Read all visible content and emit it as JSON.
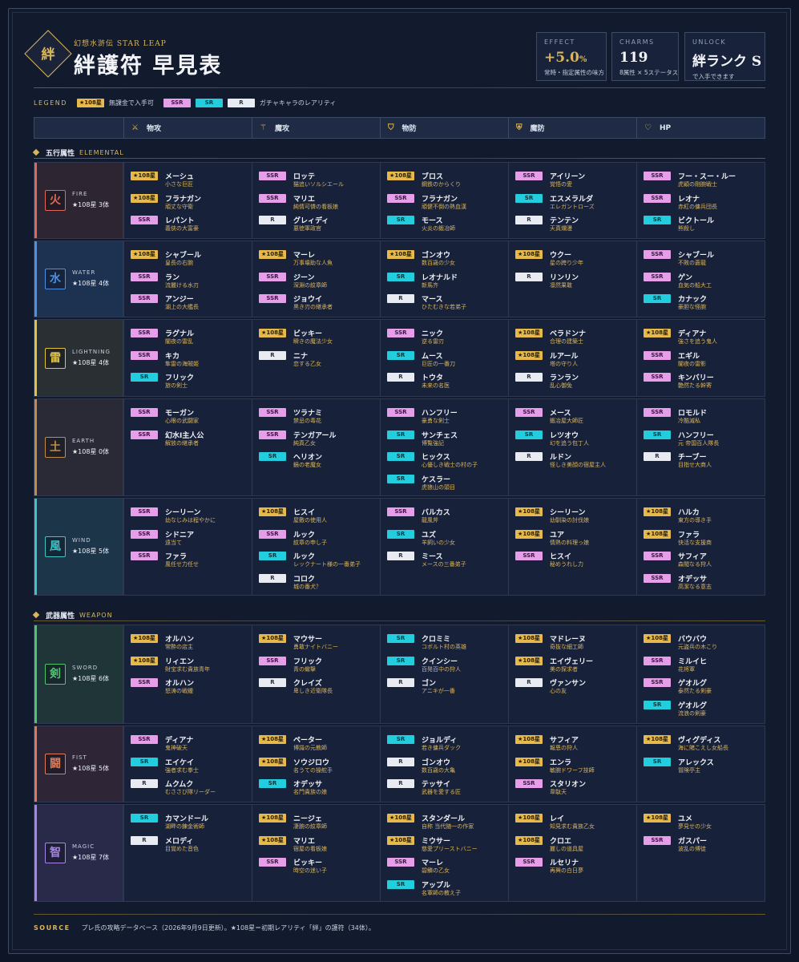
{
  "header": {
    "logo_char": "絆",
    "subtitle": "幻想水滸伝 STAR LEAP",
    "title": "絆護符 早見表"
  },
  "stats": [
    {
      "label": "EFFECT",
      "value": "+5.0",
      "unit": "%",
      "note": "常時・指定属性の味方"
    },
    {
      "label": "CHARMS",
      "value": "119",
      "note": "8属性 × 5ステータス"
    },
    {
      "label": "UNLOCK",
      "value": "絆ランク S",
      "note": "で入手できます"
    }
  ],
  "legend": {
    "title": "LEGEND",
    "star_badge": "★108星",
    "star_text": "無課金で入手可",
    "ssr": "SSR",
    "sr": "SR",
    "r": "R",
    "rarity_text": "ガチャキャラのレアリティ"
  },
  "columns": [
    {
      "label": "物攻",
      "icon": "sword-icon"
    },
    {
      "label": "魔攻",
      "icon": "wand-icon"
    },
    {
      "label": "物防",
      "icon": "shield-icon"
    },
    {
      "label": "魔防",
      "icon": "magic-shield-icon"
    },
    {
      "label": "HP",
      "icon": "heart-icon"
    }
  ],
  "colors": {
    "gold": "#d9b55c",
    "star": "#e6b94a",
    "ssr": "#e79ee8",
    "sr": "#22cddd",
    "r": "#e8ebf1"
  },
  "sections": [
    {
      "title": "五行属性",
      "title_en": "ELEMENTAL",
      "rows": [
        {
          "kanji": "火",
          "en": "FIRE",
          "count": "★108星 3体",
          "color": "#e0685a",
          "bg": "#2d2532",
          "cells": [
            [
              {
                "r": "star",
                "n": "メーシュ",
                "s": "小さな巨匠"
              },
              {
                "r": "star",
                "n": "フラナガン",
                "s": "頑丈な守衛"
              },
              {
                "r": "ssr",
                "n": "レパント",
                "s": "義俠の大富豪"
              }
            ],
            [
              {
                "r": "ssr",
                "n": "ロッテ",
                "s": "猫追いソルシエール"
              },
              {
                "r": "ssr",
                "n": "マリエ",
                "s": "純情可憐の看板娘"
              },
              {
                "r": "r",
                "n": "グレィディ",
                "s": "悪徳軍政官"
              }
            ],
            [
              {
                "r": "star",
                "n": "ブロス",
                "s": "鋼鉄のからくり"
              },
              {
                "r": "ssr",
                "n": "フラナガン",
                "s": "頑健不倒の熱血漢"
              },
              {
                "r": "sr",
                "n": "モース",
                "s": "火炎の鍛冶師"
              }
            ],
            [
              {
                "r": "ssr",
                "n": "アイリーン",
                "s": "覚悟の愛"
              },
              {
                "r": "sr",
                "n": "エスメラルダ",
                "s": "エレガントローズ"
              },
              {
                "r": "r",
                "n": "テンテン",
                "s": "天真爛漫"
              }
            ],
            [
              {
                "r": "ssr",
                "n": "フー・スー・ルー",
                "s": "虎穎の剛腕戦士"
              },
              {
                "r": "ssr",
                "n": "レオナ",
                "s": "赤紅の傭兵団長"
              },
              {
                "r": "sr",
                "n": "ビクトール",
                "s": "熊殺し"
              }
            ]
          ]
        },
        {
          "kanji": "水",
          "en": "WATER",
          "count": "★108星 4体",
          "color": "#4d8fe0",
          "bg": "#1d3150",
          "cells": [
            [
              {
                "r": "star",
                "n": "シャブール",
                "s": "皇長の右腕"
              },
              {
                "r": "ssr",
                "n": "ラン",
                "s": "流麗ける水刃"
              },
              {
                "r": "ssr",
                "n": "アンジー",
                "s": "湖上の大艦長"
              }
            ],
            [
              {
                "r": "star",
                "n": "マーレ",
                "s": "万事壊助な人魚"
              },
              {
                "r": "ssr",
                "n": "ジーン",
                "s": "深淵の紋章師"
              },
              {
                "r": "ssr",
                "n": "ジョウイ",
                "s": "黒き刃の継承者"
              }
            ],
            [
              {
                "r": "star",
                "n": "ゴンオウ",
                "s": "数百歳の少女"
              },
              {
                "r": "sr",
                "n": "レオナルド",
                "s": "新馬齐"
              },
              {
                "r": "r",
                "n": "マース",
                "s": "ひたむきな若弟子"
              }
            ],
            [
              {
                "r": "star",
                "n": "ウクー",
                "s": "星の跨り少年"
              },
              {
                "r": "r",
                "n": "リンリン",
                "s": "凛然果敢"
              }
            ],
            [
              {
                "r": "ssr",
                "n": "シャブール",
                "s": "不敗の蒼龍"
              },
              {
                "r": "ssr",
                "n": "ゲン",
                "s": "血気の船大工"
              },
              {
                "r": "sr",
                "n": "カナック",
                "s": "豪胆な怪腕"
              }
            ]
          ]
        },
        {
          "kanji": "雷",
          "en": "LIGHTNING",
          "count": "★108星 4体",
          "color": "#e2c43c",
          "bg": "#2a2f33",
          "cells": [
            [
              {
                "r": "ssr",
                "n": "ラグナル",
                "s": "闇夜の雷乱"
              },
              {
                "r": "ssr",
                "n": "キカ",
                "s": "隼雷の海賊姫"
              },
              {
                "r": "sr",
                "n": "フリック",
                "s": "旅の剣士"
              }
            ],
            [
              {
                "r": "star",
                "n": "ビッキー",
                "s": "瞬きの魔法少女"
              },
              {
                "r": "r",
                "n": "ニナ",
                "s": "恋する乙女"
              }
            ],
            [
              {
                "r": "ssr",
                "n": "ニック",
                "s": "逆る雷刃"
              },
              {
                "r": "sr",
                "n": "ムース",
                "s": "巨匠の一番刀"
              },
              {
                "r": "r",
                "n": "トウタ",
                "s": "未来の名医"
              }
            ],
            [
              {
                "r": "star",
                "n": "ベラドンナ",
                "s": "合理の建築士"
              },
              {
                "r": "star",
                "n": "ルアール",
                "s": "塔の守り人"
              },
              {
                "r": "r",
                "n": "ランラン",
                "s": "乱心御免"
              }
            ],
            [
              {
                "r": "star",
                "n": "ディアナ",
                "s": "強さを追う鬼人"
              },
              {
                "r": "ssr",
                "n": "エギル",
                "s": "闇夜の雷影"
              },
              {
                "r": "ssr",
                "n": "キンバリー",
                "s": "艶然たる幹寄"
              }
            ]
          ]
        },
        {
          "kanji": "土",
          "en": "EARTH",
          "count": "★108星 0体",
          "color": "#c18c4a",
          "bg": "#2a2a36",
          "cells": [
            [
              {
                "r": "ssr",
                "n": "モーガン",
                "s": "心眼の武闘家"
              },
              {
                "r": "ssr",
                "n": "幻水Ⅰ主人公",
                "s": "解放の継承者"
              }
            ],
            [
              {
                "r": "ssr",
                "n": "ツラナミ",
                "s": "禁忌の毒花"
              },
              {
                "r": "ssr",
                "n": "テンガアール",
                "s": "純真乙女"
              },
              {
                "r": "sr",
                "n": "ヘリオン",
                "s": "鏡の老魔女"
              }
            ],
            [
              {
                "r": "ssr",
                "n": "ハンフリー",
                "s": "豪勇な剣士"
              },
              {
                "r": "sr",
                "n": "サンチェス",
                "s": "博覧強記"
              },
              {
                "r": "sr",
                "n": "ヒックス",
                "s": "心優しき戦士の村の子"
              },
              {
                "r": "sr",
                "n": "ケスラー",
                "s": "虎狼山の頭目"
              }
            ],
            [
              {
                "r": "ssr",
                "n": "メース",
                "s": "鍛冶屋大師匠"
              },
              {
                "r": "sr",
                "n": "レツオウ",
                "s": "幻を追う包丁人"
              },
              {
                "r": "r",
                "n": "ルドン",
                "s": "怪しき美顔の宿屋主人"
              }
            ],
            [
              {
                "r": "ssr",
                "n": "ロモルド",
                "s": "冷酷滅私"
              },
              {
                "r": "sr",
                "n": "ハンフリー",
                "s": "元 帝国百人隊長"
              },
              {
                "r": "r",
                "n": "チーブー",
                "s": "目指せ大商人"
              }
            ]
          ]
        },
        {
          "kanji": "風",
          "en": "WIND",
          "count": "★108星 5体",
          "color": "#3fc4c6",
          "bg": "#1d3548",
          "cells": [
            [
              {
                "r": "ssr",
                "n": "シーリーン",
                "s": "幼なじみは程やかに"
              },
              {
                "r": "ssr",
                "n": "シドニア",
                "s": "遠当て"
              },
              {
                "r": "ssr",
                "n": "ファラ",
                "s": "風任せ力任せ"
              }
            ],
            [
              {
                "r": "star",
                "n": "ヒスイ",
                "s": "屋敷の使用人"
              },
              {
                "r": "ssr",
                "n": "ルック",
                "s": "紋章の申し子"
              },
              {
                "r": "sr",
                "n": "ルック",
                "s": "レックナート様の一番弟子"
              },
              {
                "r": "r",
                "n": "コロク",
                "s": "城の番犬？"
              }
            ],
            [
              {
                "r": "ssr",
                "n": "バルカス",
                "s": "龍風斧"
              },
              {
                "r": "sr",
                "n": "ユズ",
                "s": "羊飼いの少女"
              },
              {
                "r": "r",
                "n": "ミース",
                "s": "メースの三番弟子"
              }
            ],
            [
              {
                "r": "star",
                "n": "シーリーン",
                "s": "幼馴染の討伐娘"
              },
              {
                "r": "star",
                "n": "ユア",
                "s": "情熱の料理っ娘"
              },
              {
                "r": "ssr",
                "n": "ヒスイ",
                "s": "秘めうれし力"
              }
            ],
            [
              {
                "r": "star",
                "n": "ハルカ",
                "s": "東方の導き手"
              },
              {
                "r": "star",
                "n": "ファラ",
                "s": "快活な支援商"
              },
              {
                "r": "ssr",
                "n": "サフィア",
                "s": "森閥なる狩人"
              },
              {
                "r": "ssr",
                "n": "オデッサ",
                "s": "高潔なる意志"
              }
            ]
          ]
        }
      ]
    },
    {
      "title": "武器属性",
      "title_en": "WEAPON",
      "rows": [
        {
          "kanji": "剣",
          "en": "SWORD",
          "count": "★108星 6体",
          "color": "#4ec470",
          "bg": "#1f3538",
          "cells": [
            [
              {
                "r": "star",
                "n": "オルハン",
                "s": "常酔の店主"
              },
              {
                "r": "star",
                "n": "リィエン",
                "s": "財宝求む貴族青年"
              },
              {
                "r": "ssr",
                "n": "オルハン",
                "s": "怒涛の戦鍾"
              }
            ],
            [
              {
                "r": "star",
                "n": "マウサー",
                "s": "勇敢ナイトバニー"
              },
              {
                "r": "ssr",
                "n": "フリック",
                "s": "青の蠍撃"
              },
              {
                "r": "r",
                "n": "クレイズ",
                "s": "卑しき近衛隊長"
              }
            ],
            [
              {
                "r": "sr",
                "n": "クロミミ",
                "s": "コボルト村の英雄"
              },
              {
                "r": "sr",
                "n": "クインシー",
                "s": "百発百中の狩人"
              },
              {
                "r": "r",
                "n": "ゴン",
                "s": "アニキが一番"
              }
            ],
            [
              {
                "r": "star",
                "n": "マドレーヌ",
                "s": "奇抜な細工師"
              },
              {
                "r": "star",
                "n": "エイヴェリー",
                "s": "美の探求者"
              },
              {
                "r": "r",
                "n": "ヴァンサン",
                "s": "心の友"
              }
            ],
            [
              {
                "r": "star",
                "n": "バウバウ",
                "s": "元盗兵の木こり"
              },
              {
                "r": "ssr",
                "n": "ミルイヒ",
                "s": "花将軍"
              },
              {
                "r": "ssr",
                "n": "ゲオルグ",
                "s": "泰然たる剣豪"
              },
              {
                "r": "sr",
                "n": "ゲオルグ",
                "s": "流浪の剣豪"
              }
            ]
          ]
        },
        {
          "kanji": "闘",
          "en": "FIST",
          "count": "★108星 5体",
          "color": "#e07a56",
          "bg": "#2e2636",
          "cells": [
            [
              {
                "r": "ssr",
                "n": "ディアナ",
                "s": "鬼神破天"
              },
              {
                "r": "sr",
                "n": "エイケイ",
                "s": "強者求む拳士"
              },
              {
                "r": "r",
                "n": "ムクムク",
                "s": "むささび隊リーダー"
              }
            ],
            [
              {
                "r": "star",
                "n": "ペーター",
                "s": "博識の元教師"
              },
              {
                "r": "star",
                "n": "ソウジロウ",
                "s": "名うての操舵手"
              },
              {
                "r": "sr",
                "n": "オデッサ",
                "s": "名門貴族の娘"
              }
            ],
            [
              {
                "r": "sr",
                "n": "ジョルディ",
                "s": "若き傭兵ダック"
              },
              {
                "r": "r",
                "n": "ゴンオウ",
                "s": "数百歳の大亀"
              },
              {
                "r": "r",
                "n": "テッサイ",
                "s": "武器を愛する匠"
              }
            ],
            [
              {
                "r": "star",
                "n": "サフィア",
                "s": "報恩の狩人"
              },
              {
                "r": "star",
                "n": "エンラ",
                "s": "敏腕ドワーフ技師"
              },
              {
                "r": "ssr",
                "n": "スタリオン",
                "s": "韋駄天"
              }
            ],
            [
              {
                "r": "star",
                "n": "ヴィグディス",
                "s": "海に賭こえし女船長"
              },
              {
                "r": "sr",
                "n": "アレックス",
                "s": "冒険亭主"
              }
            ]
          ]
        },
        {
          "kanji": "智",
          "en": "MAGIC",
          "count": "★108星 7体",
          "color": "#a984e6",
          "bg": "#29294a",
          "cells": [
            [
              {
                "r": "sr",
                "n": "カマンドール",
                "s": "湖畔の錬金術師"
              },
              {
                "r": "r",
                "n": "メロディ",
                "s": "目覚めた音色"
              }
            ],
            [
              {
                "r": "star",
                "n": "ニージェ",
                "s": "凄腕の紋章師"
              },
              {
                "r": "star",
                "n": "マリエ",
                "s": "宿屋の看板娘"
              },
              {
                "r": "ssr",
                "n": "ビッキー",
                "s": "時空の迷い子"
              }
            ],
            [
              {
                "r": "star",
                "n": "スタンダール",
                "s": "自称 当代随一の作家"
              },
              {
                "r": "star",
                "n": "ミウサー",
                "s": "慈愛プリーストバニー"
              },
              {
                "r": "ssr",
                "n": "マーレ",
                "s": "碧鱗の乙女"
              },
              {
                "r": "sr",
                "n": "アップル",
                "s": "名軍師の教え子"
              }
            ],
            [
              {
                "r": "star",
                "n": "レイ",
                "s": "知見求む貴族乙女"
              },
              {
                "r": "star",
                "n": "クロエ",
                "s": "麗しの道具屋"
              },
              {
                "r": "ssr",
                "n": "ルセリナ",
                "s": "再興の白日夢"
              }
            ],
            [
              {
                "r": "star",
                "n": "ユメ",
                "s": "夢見せの少女"
              },
              {
                "r": "ssr",
                "n": "ガスパー",
                "s": "波乱の博徒"
              }
            ]
          ]
        }
      ]
    }
  ],
  "footer": {
    "label": "SOURCE",
    "text": "プレ氏の攻略データベース（2026年9月9日更新）。★108星＝初期レアリティ「絆」の護符（34体）。"
  }
}
